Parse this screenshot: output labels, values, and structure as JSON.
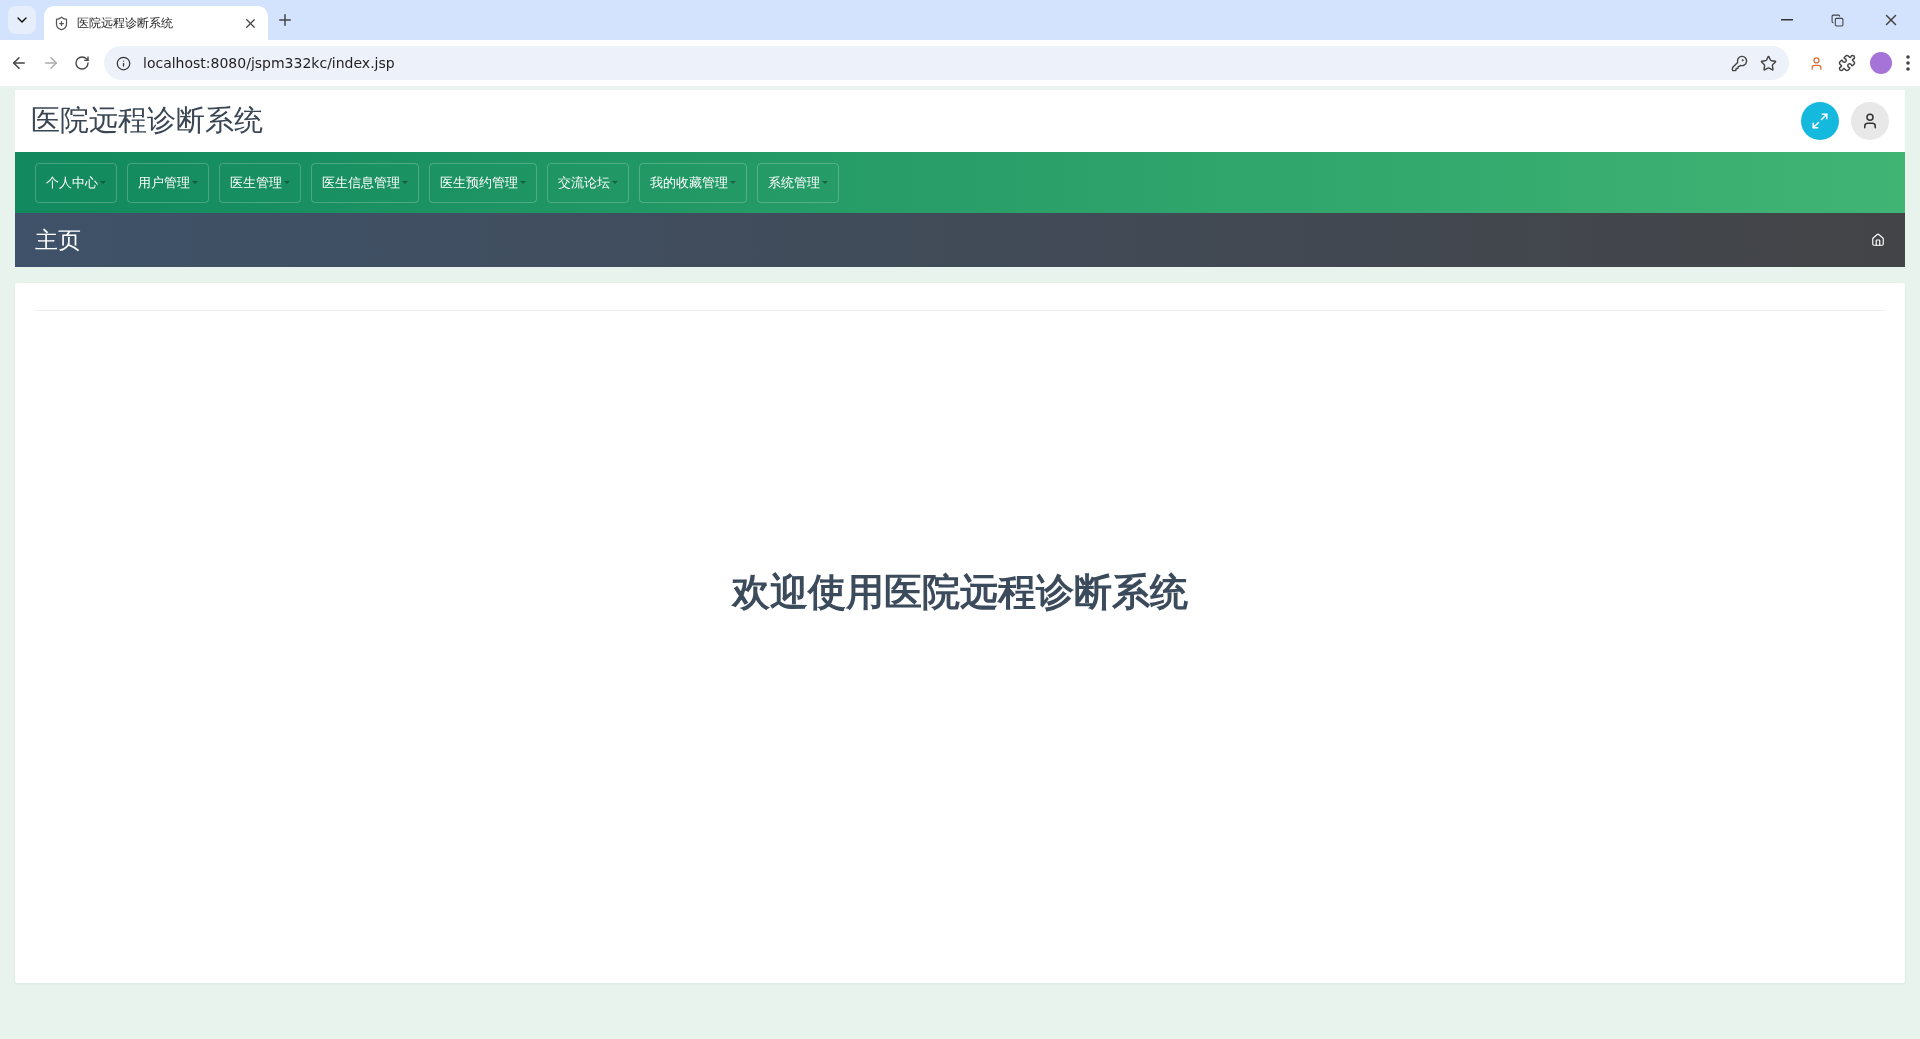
{
  "browser": {
    "tab_title": "医院远程诊断系统",
    "url": "localhost:8080/jspm332kc/index.jsp"
  },
  "header": {
    "title": "医院远程诊断系统"
  },
  "nav": [
    {
      "label": "个人中心",
      "has_menu": true
    },
    {
      "label": "用户管理",
      "has_menu": true
    },
    {
      "label": "医生管理",
      "has_menu": true
    },
    {
      "label": "医生信息管理",
      "has_menu": true
    },
    {
      "label": "医生预约管理",
      "has_menu": true
    },
    {
      "label": "交流论坛",
      "has_menu": true
    },
    {
      "label": "我的收藏管理",
      "has_menu": true
    },
    {
      "label": "系统管理",
      "has_menu": true
    }
  ],
  "breadcrumb": {
    "title": "主页"
  },
  "content": {
    "welcome": "欢迎使用医院远程诊断系统"
  }
}
